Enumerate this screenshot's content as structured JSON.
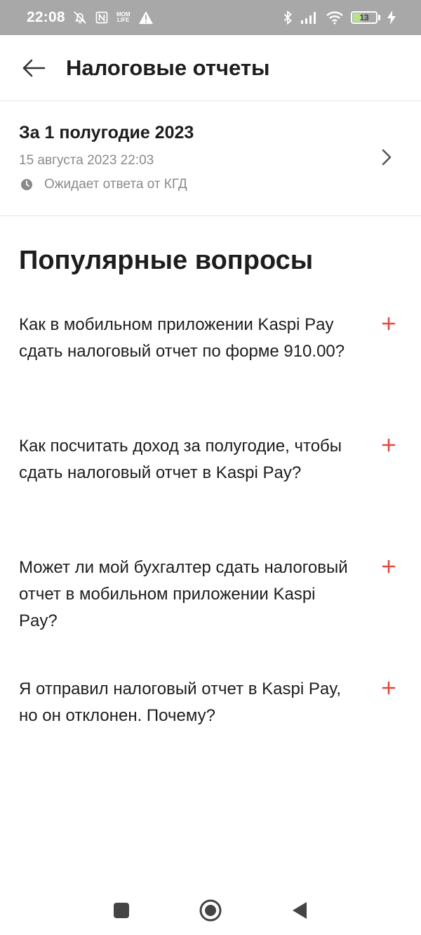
{
  "status_bar": {
    "time": "22:08",
    "mini_label": "MOM LIFE",
    "battery_level": "13",
    "icons": [
      "bell-off-icon",
      "nfc-icon",
      "mom-life-icon",
      "warning-icon",
      "bluetooth-icon",
      "signal-icon",
      "wifi-icon",
      "battery-icon",
      "charging-icon"
    ]
  },
  "header": {
    "title": "Налоговые отчеты",
    "back_icon": "arrow-left-icon"
  },
  "report": {
    "title": "За 1 полугодие 2023",
    "date": "15 августа 2023 22:03",
    "status": "Ожидает ответа от КГД",
    "status_icon": "clock-icon",
    "chevron_icon": "chevron-right-icon"
  },
  "faq": {
    "heading": "Популярные вопросы",
    "items": [
      {
        "question": "Как в мобильном приложении Kaspi Pay сдать налоговый отчет по форме 910.00?"
      },
      {
        "question": "Как посчитать доход за полугодие, чтобы сдать налоговый отчет в Kaspi Pay?"
      },
      {
        "question": "Может ли мой бухгалтер сдать налоговый отчет в мобильном приложении Kaspi Pay?"
      },
      {
        "question": "Я отправил налоговый отчет в Kaspi Pay, но он отклонен. Почему?"
      }
    ],
    "expand_icon": "plus-icon"
  },
  "nav": {
    "icons": [
      "recent-apps-icon",
      "home-icon",
      "back-triangle-icon"
    ]
  },
  "colors": {
    "accent": "#e14a3c",
    "status_bar_bg": "#a8a8a8",
    "text_primary": "#1d1d1d",
    "text_secondary": "#8a8a8a",
    "divider": "#e6e6e6",
    "battery_fill": "#b7e38a"
  }
}
